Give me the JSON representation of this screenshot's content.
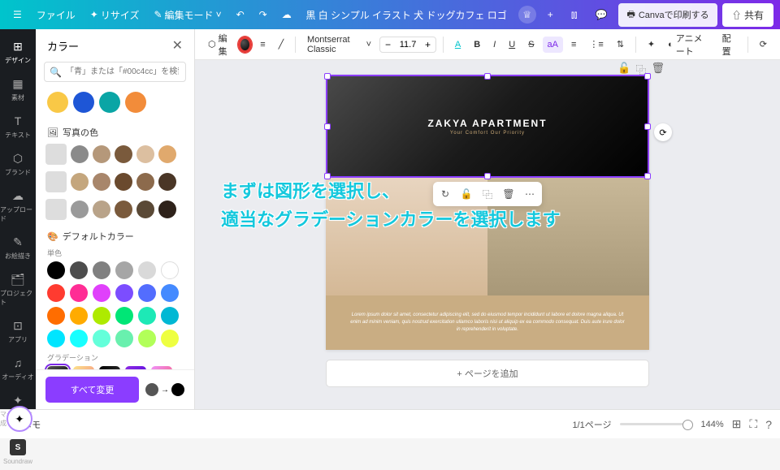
{
  "topbar": {
    "file": "ファイル",
    "resize": "リサイズ",
    "edit_mode": "編集モード",
    "doc_name": "黒 白 シンプル イラスト 犬 ドッグカフェ ロゴ",
    "print": "Canvaで印刷する",
    "share": "共有"
  },
  "rail": [
    {
      "label": "デザイン",
      "icon": "⊞"
    },
    {
      "label": "素材",
      "icon": "▦"
    },
    {
      "label": "テキスト",
      "icon": "T"
    },
    {
      "label": "ブランド",
      "icon": "⬡"
    },
    {
      "label": "アップロード",
      "icon": "☁"
    },
    {
      "label": "お絵描き",
      "icon": "✎"
    },
    {
      "label": "プロジェクト",
      "icon": "🗂"
    },
    {
      "label": "アプリ",
      "icon": "⊡"
    },
    {
      "label": "オーディオ",
      "icon": "♫"
    },
    {
      "label": "マジック生成",
      "icon": "✦"
    }
  ],
  "panel": {
    "title": "カラー",
    "search_placeholder": "「青」または「#00c4cc」を検索",
    "doc_colors": [
      "#f9c846",
      "#1e56d6",
      "#0aa5a5",
      "#f28c3a"
    ],
    "photo_section": "写真の色",
    "photo_rows": [
      [
        "#8a8a8a",
        "#b5987a",
        "#7a5a3c",
        "#dcbfa0",
        "#e0a96d"
      ],
      [
        "#c4a67d",
        "#a8866b",
        "#6a4a2e",
        "#8c6a4c",
        "#4a3626"
      ],
      [
        "#9a9a9a",
        "#b9a389",
        "#7a5a3c",
        "#5a4936",
        "#2e221a"
      ]
    ],
    "default_section": "デフォルトカラー",
    "solid_label": "単色",
    "solid": [
      [
        "#000",
        "#4d4d4d",
        "#808080",
        "#a6a6a6",
        "#d9d9d9",
        "#fff"
      ],
      [
        "#ff3b30",
        "#ff2d95",
        "#e040fb",
        "#7c4dff",
        "#536dfe",
        "#448aff"
      ],
      [
        "#ff6d00",
        "#ffab00",
        "#aeea00",
        "#00e676",
        "#1de9b6",
        "#00b8d4"
      ],
      [
        "#00e5ff",
        "#18ffff",
        "#64ffda",
        "#69f0ae",
        "#b2ff59",
        "#eeff41"
      ]
    ],
    "grad_label": "グラデーション",
    "gradients": [
      "linear-gradient(135deg,#555,#000)",
      "linear-gradient(135deg,#fce38a,#f38181)",
      "linear-gradient(135deg,#000,#434343)",
      "linear-gradient(135deg,#8e2de2,#4a00e0)",
      "linear-gradient(135deg,#f093fb,#f5576c)",
      "linear-gradient(135deg,#4facfe,#00f2fe)",
      "linear-gradient(135deg,#fa709a,#fee140)",
      "linear-gradient(135deg,#ff6a00,#ee0979)",
      "linear-gradient(135deg,#ff0844,#ffb199)",
      "linear-gradient(135deg,#667eea,#764ba2)",
      "linear-gradient(135deg,#2193b0,#6dd5ed)",
      "linear-gradient(135deg,#cc2b5e,#753a88)"
    ],
    "change_all": "すべて変更"
  },
  "toolbar": {
    "edit": "編集",
    "font": "Montserrat Classic",
    "size": "11.7",
    "animate": "アニメート",
    "position": "配置"
  },
  "page": {
    "hero_title": "ZAKYA APARTMENT",
    "hero_sub": "Your Comfort Our Priority",
    "lorem": "Lorem ipsum dolor sit amet, consectetur adipiscing elit, sed do eiusmod tempor incididunt ut labore et dolore magna aliqua. Ut enim ad minim veniam, quis nostrud exercitation ullamco laboris nisi ut aliquip ex ea commodo consequat. Duis aute irure dolor in reprehenderit in voluptate.",
    "add_page": "+ ページを追加"
  },
  "overlay": {
    "line1": "まずは図形を選択し、",
    "line2": "適当なグラデーションカラーを選択します"
  },
  "status": {
    "memo": "メモ",
    "pages": "1/1ページ",
    "zoom": "144%"
  }
}
